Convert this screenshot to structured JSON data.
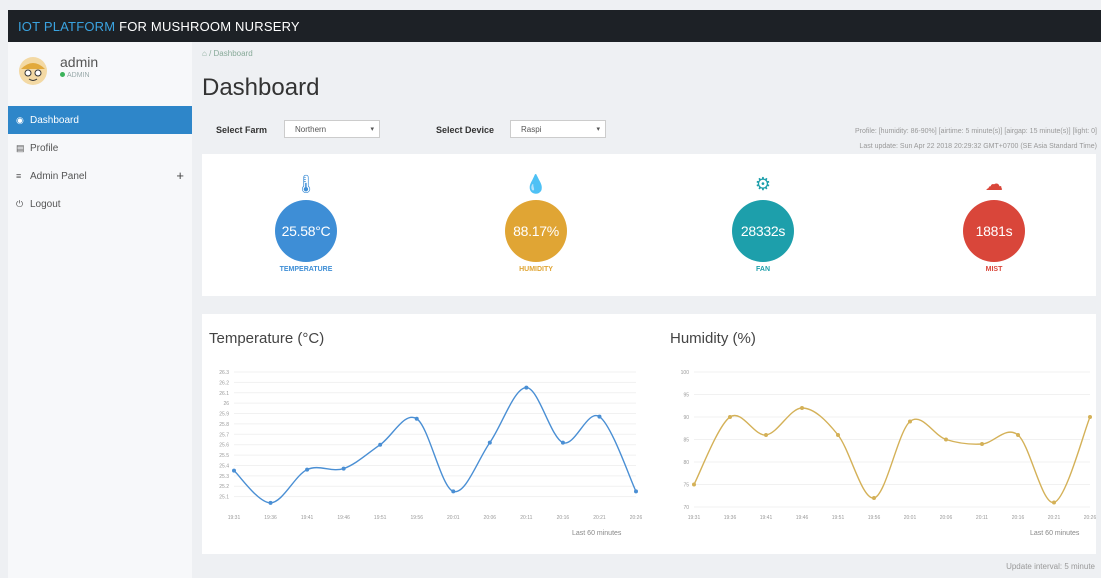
{
  "app": {
    "brand_highlight": "IOT PLATFORM",
    "brand_rest": " FOR MUSHROOM NURSERY"
  },
  "user": {
    "name": "admin",
    "role": "ADMIN"
  },
  "nav": [
    {
      "label": "Dashboard",
      "icon": "dashboard-icon",
      "active": true
    },
    {
      "label": "Profile",
      "icon": "calendar-icon",
      "active": false
    },
    {
      "label": "Admin Panel",
      "icon": "list-icon",
      "active": false
    },
    {
      "label": "Logout",
      "icon": "power-icon",
      "active": false
    }
  ],
  "breadcrumb": "Dashboard",
  "page_title": "Dashboard",
  "filters": {
    "farm_label": "Select Farm",
    "farm_value": "Northern",
    "device_label": "Select Device",
    "device_value": "Raspi"
  },
  "profile_line": "Profile: [humidity: 86-90%] [airtime: 5 minute(s)] [airgap: 15 minute(s)] [light: 0]",
  "last_update": "Last update: Sun Apr 22 2018 20:29:32 GMT+0700 (SE Asia Standard Time)",
  "sensors": [
    {
      "value": "25.58°C",
      "label": "TEMPERATURE",
      "color": "#3e8ed6",
      "icon": "thermometer-icon"
    },
    {
      "value": "88.17%",
      "label": "HUMIDITY",
      "color": "#e0a534",
      "icon": "water-drop-icon"
    },
    {
      "value": "28332s",
      "label": "FAN",
      "color": "#1d9fab",
      "icon": "fan-icon"
    },
    {
      "value": "1881s",
      "label": "MIST",
      "color": "#d9463a",
      "icon": "cloud-icon"
    }
  ],
  "chart_data": [
    {
      "type": "line",
      "title": "Temperature (°C)",
      "x": [
        "19:31",
        "19:36",
        "19:41",
        "19:46",
        "19:51",
        "19:56",
        "20:01",
        "20:06",
        "20:11",
        "20:16",
        "20:21",
        "20:26"
      ],
      "values": [
        25.35,
        25.04,
        25.36,
        25.37,
        25.6,
        25.85,
        25.15,
        25.62,
        26.15,
        25.62,
        25.87,
        25.15
      ],
      "yticks": [
        "25.1",
        "25.2",
        "25.3",
        "25.4",
        "25.5",
        "25.6",
        "25.7",
        "25.8",
        "25.9",
        "26",
        "26.1",
        "26.2",
        "26.3"
      ],
      "ylim": [
        25.0,
        26.3
      ],
      "color": "#4a8fd4",
      "footer": "Last 60 minutes"
    },
    {
      "type": "line",
      "title": "Humidity (%)",
      "x": [
        "19:31",
        "19:36",
        "19:41",
        "19:46",
        "19:51",
        "19:56",
        "20:01",
        "20:06",
        "20:11",
        "20:16",
        "20:21",
        "20:26"
      ],
      "values": [
        75,
        90,
        86,
        92,
        86,
        72,
        89,
        85,
        84,
        86,
        71,
        90
      ],
      "yticks": [
        "70",
        "75",
        "80",
        "85",
        "90",
        "95",
        "100"
      ],
      "ylim": [
        70,
        100
      ],
      "color": "#d4b158",
      "footer": "Last 60 minutes"
    }
  ],
  "footer": "Update interval: 5 minute"
}
